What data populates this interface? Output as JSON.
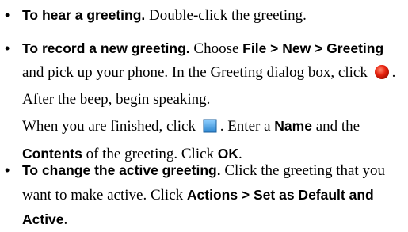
{
  "bullet_glyph": "•",
  "items": [
    {
      "title": "To hear a greeting.",
      "text": " Double-click the greeting."
    },
    {
      "title": "To record a new greeting.",
      "t1": " Choose ",
      "menu_path": "File > New > Greeting",
      "t2": " and pick up your phone. In the Greeting dialog box, click ",
      "record_icon": "record-icon",
      "record_color": "#e8220f",
      "t3": ". After the beep, begin speaking.",
      "c1": "When you are finished, click ",
      "stop_icon": "stop-icon",
      "stop_color": "#4aa3e0",
      "c2": ". Enter a ",
      "name_label": "Name",
      "c3": " and the ",
      "contents_label": "Contents",
      "c4": " of the greeting. Click ",
      "ok_label": "OK",
      "c5": "."
    },
    {
      "title": "To change the active greeting.",
      "t1": " Click the greeting that you want to make active. Click ",
      "menu_path": "Actions > Set as Default and Active",
      "t2": "."
    }
  ]
}
